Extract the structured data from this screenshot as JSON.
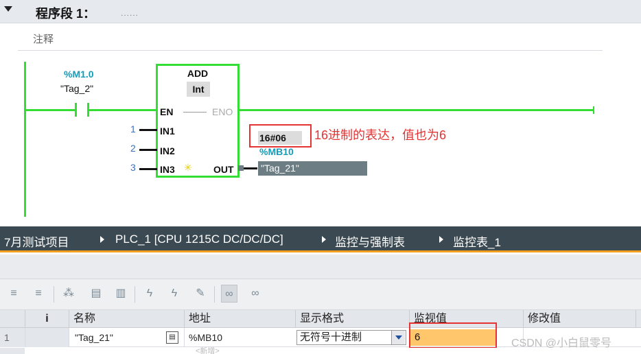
{
  "network": {
    "title": "程序段 1：",
    "dots": "......",
    "comment": "注释"
  },
  "ladder": {
    "contact_address": "%M1.0",
    "contact_tag": "\"Tag_2\"",
    "block_name": "ADD",
    "block_type": "Int",
    "pin_en": "EN",
    "pin_eno": "ENO",
    "pin_in1": "IN1",
    "pin_in2": "IN2",
    "pin_in3": "IN3",
    "pin_out": "OUT",
    "in1_value": "1",
    "in2_value": "2",
    "in3_value": "3",
    "monitor_value": "16#06",
    "out_address": "%MB10",
    "out_tag": "\"Tag_21\""
  },
  "annotation": "16进制的表达，值也为6",
  "breadcrumb": {
    "items": [
      "7月测试项目",
      "PLC_1 [CPU 1215C DC/DC/DC]",
      "监控与强制表",
      "监控表_1"
    ]
  },
  "table": {
    "headers": {
      "i": "i",
      "name": "名称",
      "address": "地址",
      "format": "显示格式",
      "monitor": "监视值",
      "modify": "修改值"
    },
    "rows": [
      {
        "num": "1",
        "name": "\"Tag_21\"",
        "address": "%MB10",
        "format": "无符号十进制",
        "monitor": "6"
      }
    ],
    "new_row_label": "<新增>"
  },
  "watermark": "CSDN @小白鼠零号",
  "colors": {
    "rung_green": "#33dd33",
    "address_blue": "#159bb8",
    "annotation_red": "#e53333",
    "breadcrumb_bg": "#3b4a52",
    "breadcrumb_accent": "#f0a01e",
    "monitor_highlight": "#ffc66b"
  },
  "toolbar_icons": [
    "insert-row-icon",
    "add-row-icon",
    "force-icon",
    "modify-icon",
    "monitor-once-icon",
    "modify-now-icon",
    "modify-trigger-icon",
    "trigger-icon",
    "monitor-all-icon",
    "monitor-once-1-icon"
  ]
}
